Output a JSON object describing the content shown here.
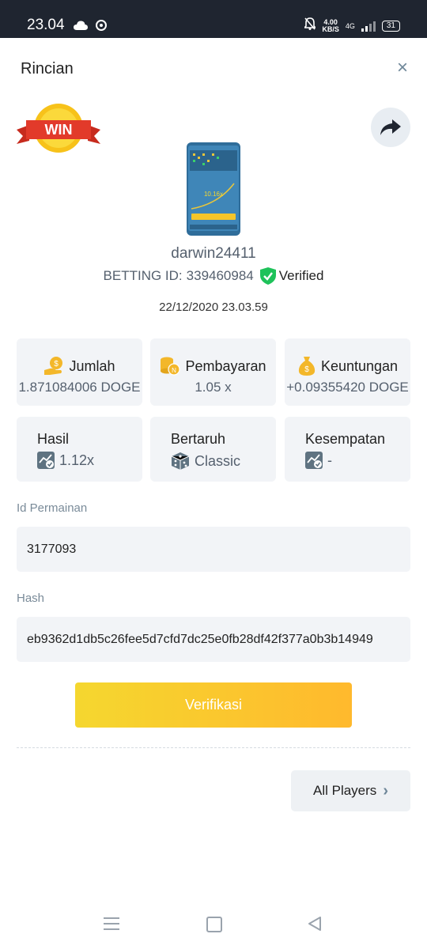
{
  "status_bar": {
    "time": "23.04",
    "speed_value": "4.00",
    "speed_unit": "KB/S",
    "network": "4G",
    "battery": "31"
  },
  "header": {
    "title": "Rincian",
    "close_symbol": "×"
  },
  "badge": {
    "text": "WIN"
  },
  "thumbnail": {
    "multiplier": "10.16x"
  },
  "bet": {
    "username": "darwin24411",
    "betting_id_label": "BETTING ID:",
    "betting_id": "339460984",
    "verified_label": "Verified",
    "datetime": "22/12/2020 23.03.59"
  },
  "stats": [
    {
      "label": "Jumlah",
      "value": "1.871084006 DOGE",
      "icon": "coin-hand-icon"
    },
    {
      "label": "Pembayaran",
      "value": "1.05 x",
      "icon": "coin-stack-icon"
    },
    {
      "label": "Keuntungan",
      "value": "+0.09355420 DOGE",
      "icon": "money-bag-icon"
    }
  ],
  "details": [
    {
      "label": "Hasil",
      "value": "1.12x",
      "icon": "chart-check-icon"
    },
    {
      "label": "Bertaruh",
      "value": "Classic",
      "icon": "dice-icon"
    },
    {
      "label": "Kesempatan",
      "value": "-",
      "icon": "chart-check-icon"
    }
  ],
  "game_id": {
    "label": "Id Permainan",
    "value": "3177093"
  },
  "hash": {
    "label": "Hash",
    "value": "eb9362d1db5c26fee5d7cfd7dc25e0fb28df42f377a0b3b14949"
  },
  "actions": {
    "verify_label": "Verifikasi",
    "all_players_label": "All Players"
  },
  "colors": {
    "accent_start": "#f5d72f",
    "accent_end": "#ffb92d",
    "verified_green": "#1ec25a",
    "card_bg": "#f2f4f7",
    "icon_gold": "#f3b72a",
    "icon_slate": "#5f7381"
  }
}
